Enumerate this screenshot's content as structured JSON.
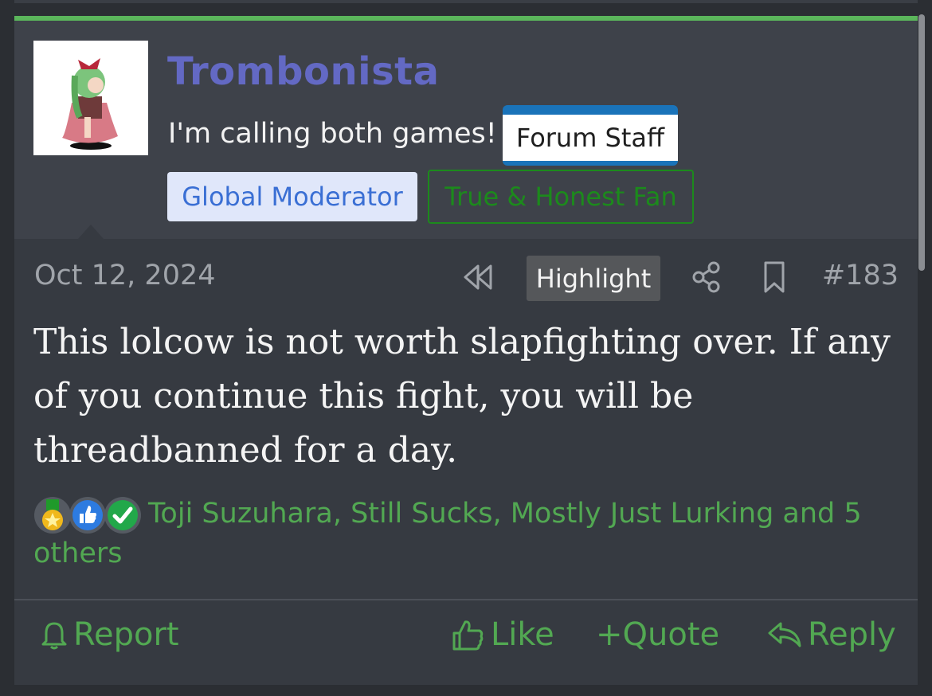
{
  "colors": {
    "accent": "#5bb65b",
    "username": "#6369c4",
    "link": "#52a852"
  },
  "user": {
    "name": "Trombonista",
    "title": "I'm calling both games!",
    "staff_badge": "Forum Staff",
    "banners": [
      "Global Moderator",
      "True & Honest Fan"
    ]
  },
  "post": {
    "date": "Oct 12, 2024",
    "highlight_label": "Highlight",
    "number": "#183",
    "body": "This lolcow is not worth slapfighting over. If any of you continue this fight, you will be threadbanned for a day.",
    "reactions_text": "Toji Suzuhara, Still Sucks, Mostly Just Lurking and 5 others",
    "reaction_icons": [
      "medal-icon",
      "thumbs-up-icon",
      "checkmark-icon"
    ]
  },
  "actions": {
    "report": "Report",
    "like": "Like",
    "quote": "+Quote",
    "reply": "Reply"
  }
}
